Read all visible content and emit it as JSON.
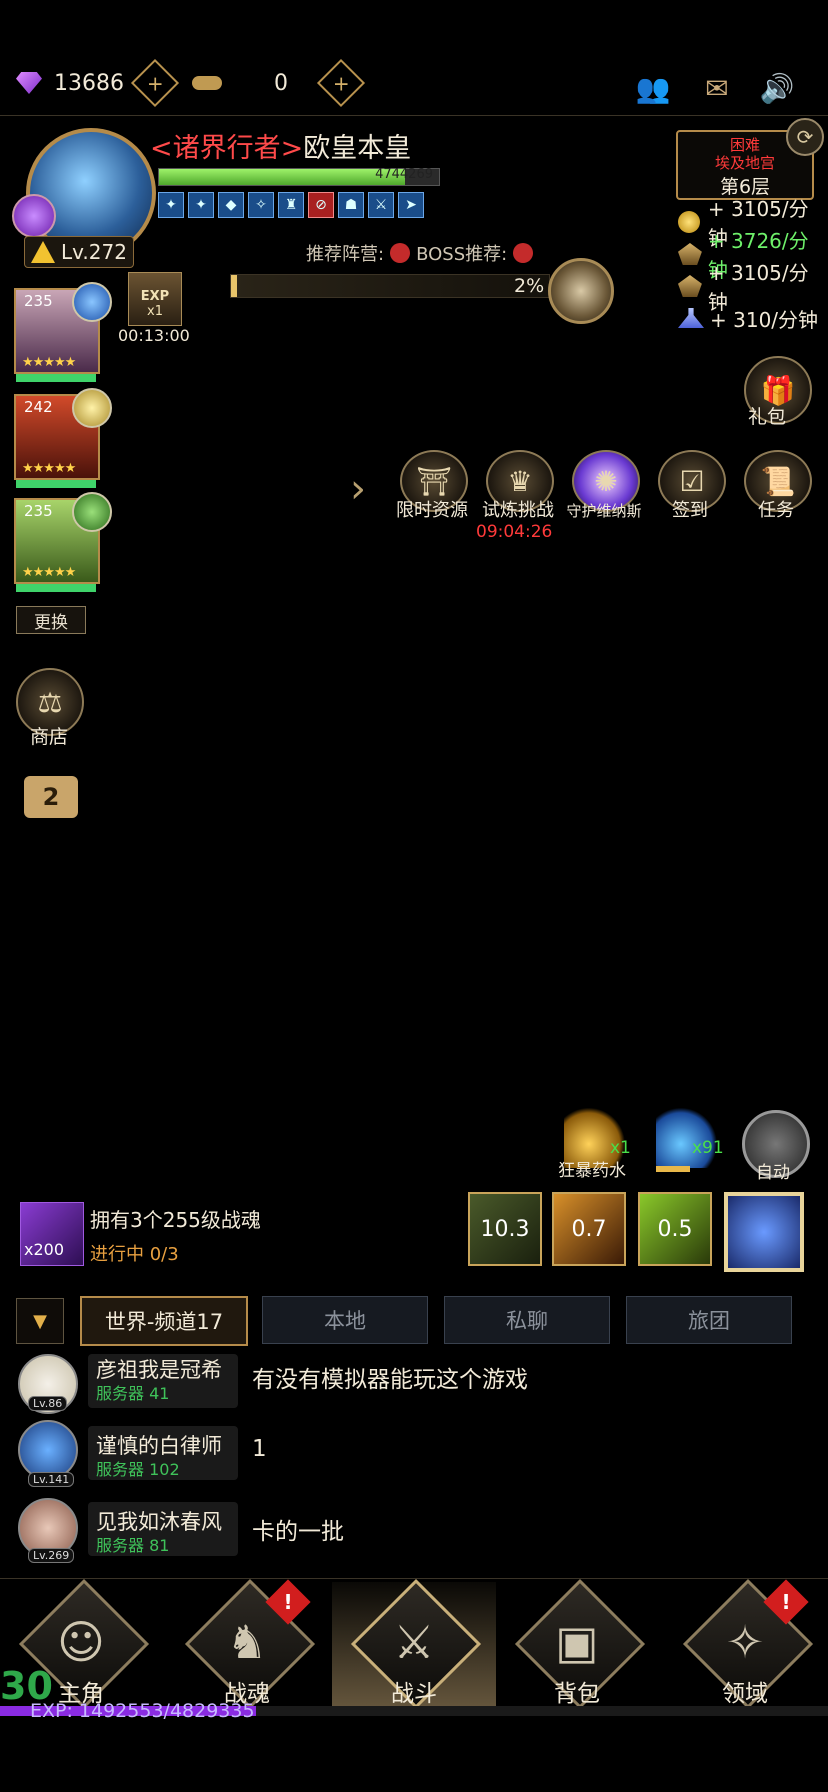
{
  "topbar": {
    "gems": "13686",
    "keys": "0",
    "icons": [
      "gem-icon",
      "plus-icon",
      "key-icon",
      "plus-icon",
      "friends-icon",
      "mail-icon",
      "speaker-icon"
    ]
  },
  "player": {
    "guild": "<诸界行者>",
    "name": "欧皇本皇",
    "hp": "4744269",
    "level": "Lv.272",
    "hp_fraction": 0.88,
    "buff_count": 9
  },
  "recommend": {
    "camp_label": "推荐阵营:",
    "boss_label": "BOSS推荐:"
  },
  "progress": {
    "percent_text": "2%",
    "value": 0.02
  },
  "exp_box": {
    "label": "EXP",
    "mult": "x1",
    "timer": "00:13:00"
  },
  "stage": {
    "difficulty": "困难",
    "map": "埃及地宫",
    "floor": "第6层"
  },
  "rates": {
    "gold": "+ 3105/分钟",
    "hero_exp": "+ 3726/分钟",
    "exp": "+ 3105/分钟",
    "essence": "+ 310/分钟"
  },
  "heroes": [
    {
      "level": "235",
      "stars": "★★★★★"
    },
    {
      "level": "242",
      "stars": "★★★★★"
    },
    {
      "level": "235",
      "stars": "★★★★★"
    }
  ],
  "swap_label": "更换",
  "shop_label": "商店",
  "camera_count": "2",
  "gift_label": "礼包",
  "activities": [
    {
      "label": "限时资源"
    },
    {
      "label": "试炼挑战",
      "timer": "09:04:26"
    },
    {
      "label": "守护维纳斯"
    },
    {
      "label": "签到"
    },
    {
      "label": "任务"
    }
  ],
  "potions": {
    "berserk_label": "狂暴药水",
    "berserk_count": "x1",
    "mana_count": "x91",
    "auto_label": "自动"
  },
  "quest": {
    "reward": "x200",
    "title": "拥有3个255级战魂",
    "progress": "进行中 0/3"
  },
  "skills": [
    "10.3",
    "0.7",
    "0.5"
  ],
  "chat_tabs": [
    "世界-频道17",
    "本地",
    "私聊",
    "旅团"
  ],
  "messages": [
    {
      "lv": "Lv.86",
      "name": "彦祖我是冠希",
      "server": "服务器 41",
      "text": "有没有模拟器能玩这个游戏"
    },
    {
      "lv": "Lv.141",
      "name": "谨慎的白律师",
      "server": "服务器 102",
      "text": "1"
    },
    {
      "lv": "Lv.269",
      "name": "见我如沐春风",
      "server": "服务器 81",
      "text": "卡的一批"
    }
  ],
  "nav": [
    {
      "label": "主角",
      "icon": "hero-icon"
    },
    {
      "label": "战魂",
      "icon": "helmet-icon"
    },
    {
      "label": "战斗",
      "icon": "crossed-swords-icon"
    },
    {
      "label": "背包",
      "icon": "backpack-icon"
    },
    {
      "label": "领域",
      "icon": "compass-icon"
    }
  ],
  "alert_mark": "!",
  "exp_bar": {
    "text": "EXP: 1492553/4829335",
    "fraction": 0.309,
    "level_fragment": "30"
  }
}
